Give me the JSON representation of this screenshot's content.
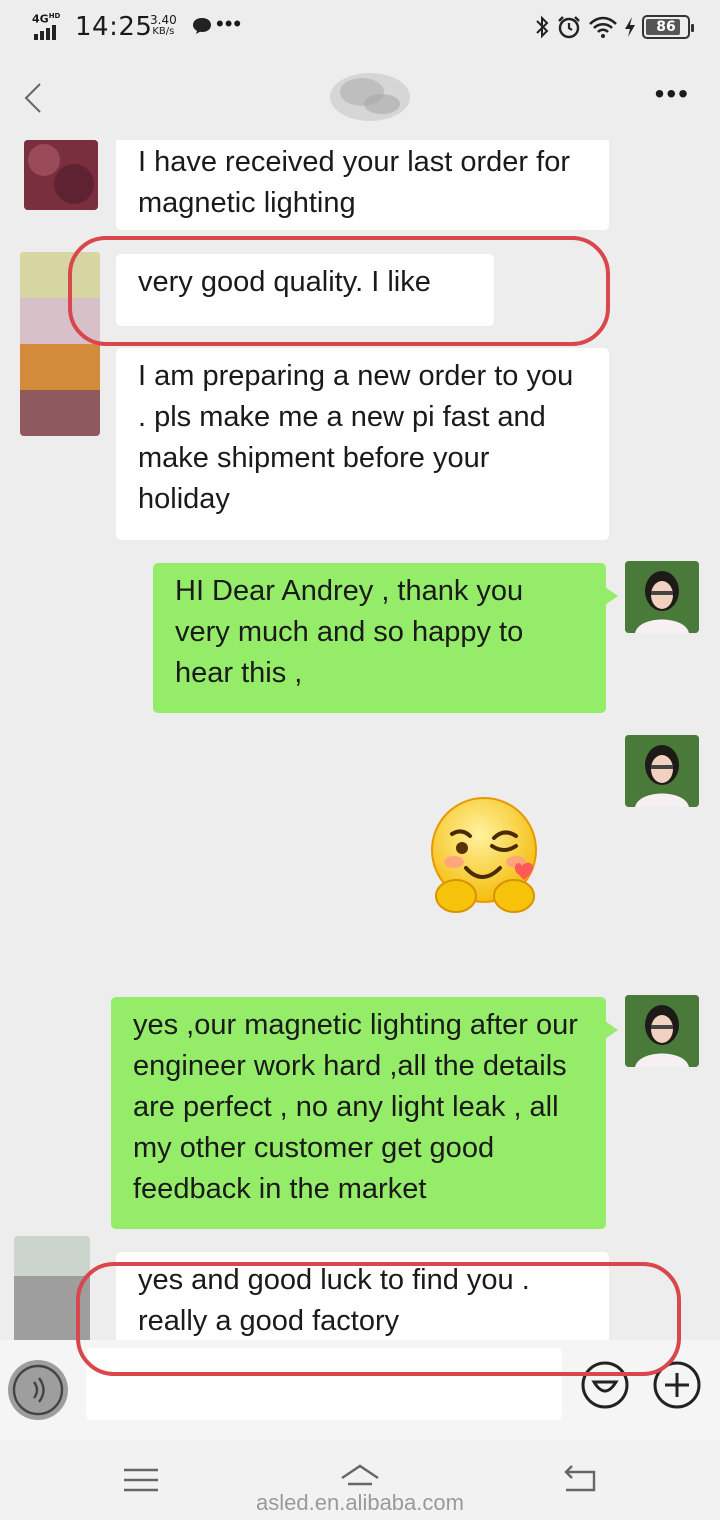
{
  "status_bar": {
    "network": "4G",
    "network_sup": "HD",
    "time": "14:25",
    "speed_value": "3.40",
    "speed_unit": "KB/s",
    "more_indicator": "•••",
    "battery": "86",
    "battery_level": 0.86,
    "icons": [
      "bluetooth-icon",
      "alarm-icon",
      "wifi-icon",
      "charging-icon"
    ]
  },
  "header": {
    "back_icon": "chevron-left-icon",
    "menu": "•••"
  },
  "messages": [
    {
      "side": "in",
      "text": "I have received your last order for magnetic lighting"
    },
    {
      "side": "in",
      "text": "very good quality. I like"
    },
    {
      "side": "in",
      "text": "I am preparing a new order to you . pls make me a new pi fast and make shipment before your holiday"
    },
    {
      "side": "out",
      "text": "HI Dear  Andrey  , thank you very much and so happy to hear this  ,"
    },
    {
      "side": "out",
      "sticker": "winking-heart-hands-emoji"
    },
    {
      "side": "out",
      "text": "yes ,our magnetic lighting after our engineer work hard ,all the details are perfect ,  no any light leak  , all my other customer get good feedback in the market"
    },
    {
      "side": "in",
      "text": "yes  and good luck to find you . really a good factory"
    }
  ],
  "input_bar": {
    "voice_icon": "voice-icon",
    "emoji_icon": "emoji-icon",
    "plus_icon": "plus-icon"
  },
  "system_nav": {
    "icons": [
      "menu-icon",
      "home-icon",
      "back-icon"
    ]
  },
  "watermark": "asled.en.alibaba.com",
  "colors": {
    "background": "#ededed",
    "outgoing": "#95ec69",
    "incoming": "#ffffff",
    "highlight": "#d9464c"
  }
}
